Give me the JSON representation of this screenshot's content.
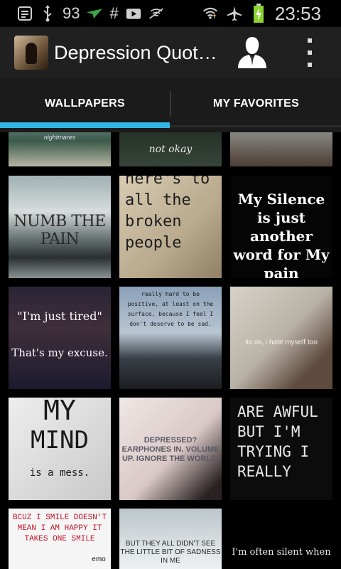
{
  "status_bar": {
    "notification_count": "93",
    "hashtag": "#",
    "time": "23:53"
  },
  "action_bar": {
    "title": "Depression Quot…"
  },
  "tabs": [
    {
      "label": "WALLPAPERS",
      "selected": true
    },
    {
      "label": "MY FAVORITES",
      "selected": false
    }
  ],
  "colors": {
    "accent": "#33b5e5",
    "actionbar_bg": "#202020",
    "tabs_bg": "#1b1b1b",
    "battery_green": "#8bd132"
  },
  "wallpapers": {
    "row0": {
      "a": "nightmares",
      "b": "not okay"
    },
    "numb": "NUMB THE PAIN",
    "broken": "here's to all the broken people",
    "silence": "My Silence is just another word for My pain",
    "tired_quote": "\"I'm just tired\"",
    "tired_excuse": "That's my excuse.",
    "positive": "really hard to be positive, at least on the surface, because I feel I don't deserve to be sad.",
    "hate": "its ok, i hate myself too",
    "mind_a": "MY",
    "mind_b": "MIND",
    "mind_c": "is a mess.",
    "earphones": "DEPRESSED? EARPHONES IN. VOLUME UP. IGNORE THE WORLD.",
    "awful": "ARE AWFUL BUT I'M TRYING I REALLY",
    "smile": "BCUZ I SMILE DOESN'T MEAN I AM HAPPY IT TAKES ONE SMILE",
    "emo": "emo",
    "sadness": "BUT THEY ALL DIDN'T SEE THE LITTLE BIT OF SADNESS IN ME",
    "silent": "I'm often silent when"
  }
}
